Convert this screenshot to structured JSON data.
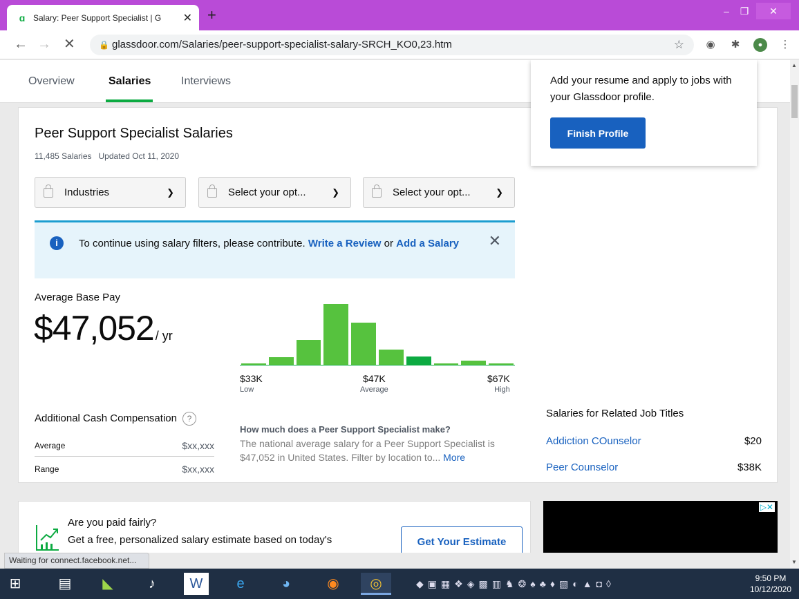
{
  "browser": {
    "tab_title": "Salary: Peer Support Specialist | G",
    "url": "glassdoor.com/Salaries/peer-support-specialist-salary-SRCH_KO0,23.htm",
    "status_text": "Waiting for connect.facebook.net..."
  },
  "page_tabs": [
    "Overview",
    "Salaries",
    "Interviews"
  ],
  "header": {
    "title": "Peer Support Specialist Salaries",
    "count": "11,485 Salaries",
    "updated": "Updated Oct 11, 2020"
  },
  "filters": [
    "Industries",
    "Select your opt...",
    "Select your opt..."
  ],
  "notice": {
    "text_prefix": "To continue using salary filters, please contribute.",
    "link1": "Write a Review",
    "or": "or",
    "link2": "Add a Salary"
  },
  "pay": {
    "label": "Average Base Pay",
    "value": "$47,052",
    "unit": "/ yr"
  },
  "chart_data": {
    "type": "bar",
    "values": [
      2,
      11,
      36,
      88,
      61,
      22,
      12,
      2,
      6,
      1
    ],
    "highlight_index": 5,
    "tick_labels": [
      {
        "value": "$33K",
        "sub": "Low"
      },
      {
        "value": "$47K",
        "sub": "Average"
      },
      {
        "value": "$67K",
        "sub": "High"
      }
    ]
  },
  "cash_comp": {
    "title": "Additional Cash Compensation",
    "rows": [
      {
        "label": "Average",
        "value": "$xx,xxx"
      },
      {
        "label": "Range",
        "value": "$xx,xxx"
      }
    ]
  },
  "faq": {
    "question": "How much does a Peer Support Specialist make?",
    "answer": "The national average salary for a Peer Support Specialist is $47,052 in United States. Filter by location to...",
    "more": "More"
  },
  "related": {
    "title": "Salaries for Related Job Titles",
    "items": [
      {
        "title": "Addiction COunselor",
        "salary": "$20"
      },
      {
        "title": "Peer Counselor",
        "salary": "$38K"
      }
    ]
  },
  "popup": {
    "text": "Add your resume and apply to jobs with your Glassdoor profile.",
    "button": "Finish Profile"
  },
  "estimate": {
    "line1": "Are you paid fairly?",
    "line2": "Get a free, personalized salary estimate based on today's",
    "button": "Get Your Estimate"
  },
  "taskbar": {
    "time": "9:50 PM",
    "date": "10/12/2020"
  },
  "colors": {
    "brand_green": "#0caa41",
    "bar_green": "#56c23e",
    "link_blue": "#1861bf",
    "browser_frame": "#b94bd7"
  }
}
